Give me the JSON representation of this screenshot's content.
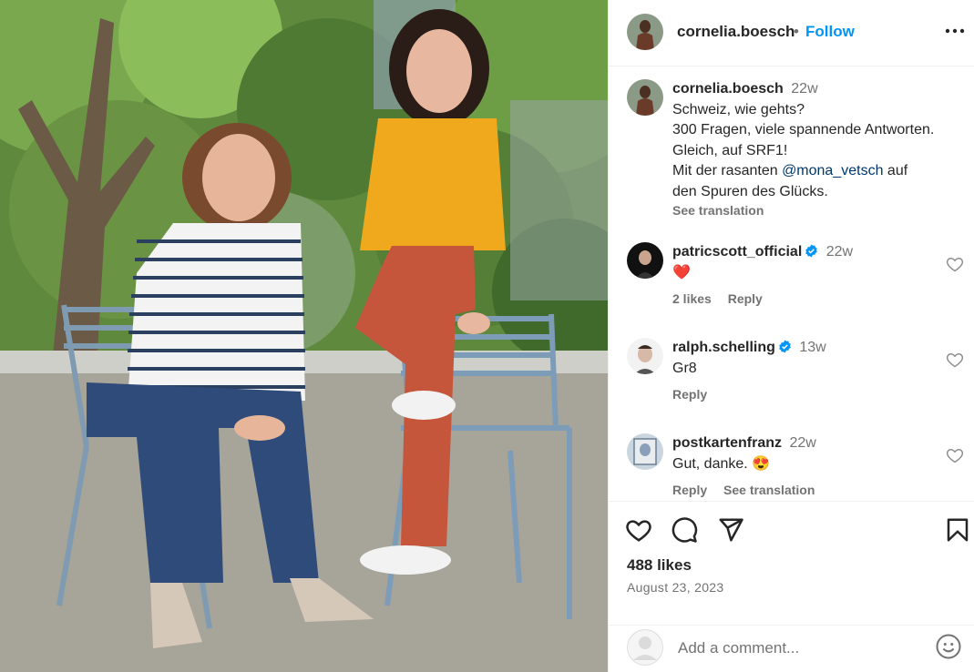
{
  "post": {
    "author": "cornelia.boesch",
    "follow_label": "Follow",
    "separator": "•"
  },
  "caption": {
    "username": "cornelia.boesch",
    "time": "22w",
    "line1": "Schweiz, wie gehts?",
    "line2": "300 Fragen, viele spannende Antworten.",
    "line3": "Gleich, auf SRF1!",
    "line4_pre": "Mit der rasanten ",
    "line4_mention": "@mona_vetsch",
    "line4_post": " auf",
    "line5": "den Spuren des Glücks.",
    "see_translation": "See translation"
  },
  "comments": [
    {
      "username": "patricscott_official",
      "verified": true,
      "time": "22w",
      "text": "❤️",
      "likes": "2 likes",
      "reply": "Reply"
    },
    {
      "username": "ralph.schelling",
      "verified": true,
      "time": "13w",
      "text": "Gr8",
      "reply": "Reply"
    },
    {
      "username": "postkartenfranz",
      "verified": false,
      "time": "22w",
      "text": "Gut, danke. 😍",
      "reply": "Reply",
      "see_translation": "See translation"
    }
  ],
  "stats": {
    "likes": "488 likes",
    "date": "August 23, 2023"
  },
  "add_comment": {
    "placeholder": "Add a comment..."
  },
  "colors": {
    "link": "#0095f6",
    "verified": "#0095f6",
    "heart": "#ed4956",
    "text": "#262626",
    "muted": "#737373"
  },
  "icons": [
    "more-icon",
    "heart-icon",
    "comment-icon",
    "share-icon",
    "bookmark-icon",
    "verified-icon",
    "emoji-icon"
  ]
}
